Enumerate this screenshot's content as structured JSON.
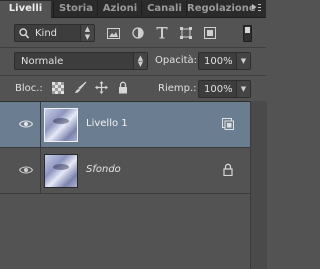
{
  "tabs": [
    {
      "label": "Livelli"
    },
    {
      "label": "Storia"
    },
    {
      "label": "Azioni"
    },
    {
      "label": "Canali"
    },
    {
      "label": "Regolazione"
    }
  ],
  "filter": {
    "kind_label": "Kind"
  },
  "blend": {
    "mode": "Normale",
    "opacity_label": "Opacità:",
    "opacity_value": "100%"
  },
  "lock": {
    "label": "Bloc.:",
    "fill_label": "Riemp.:",
    "fill_value": "100%"
  },
  "layers": [
    {
      "name": "Livello 1",
      "selected": true,
      "badge_icon": "smart-object-icon"
    },
    {
      "name": "Sfondo",
      "selected": false,
      "badge_icon": "lock-icon"
    }
  ],
  "colors": {
    "accent_selected": "#6b7d91",
    "panel_bg": "#535353"
  }
}
